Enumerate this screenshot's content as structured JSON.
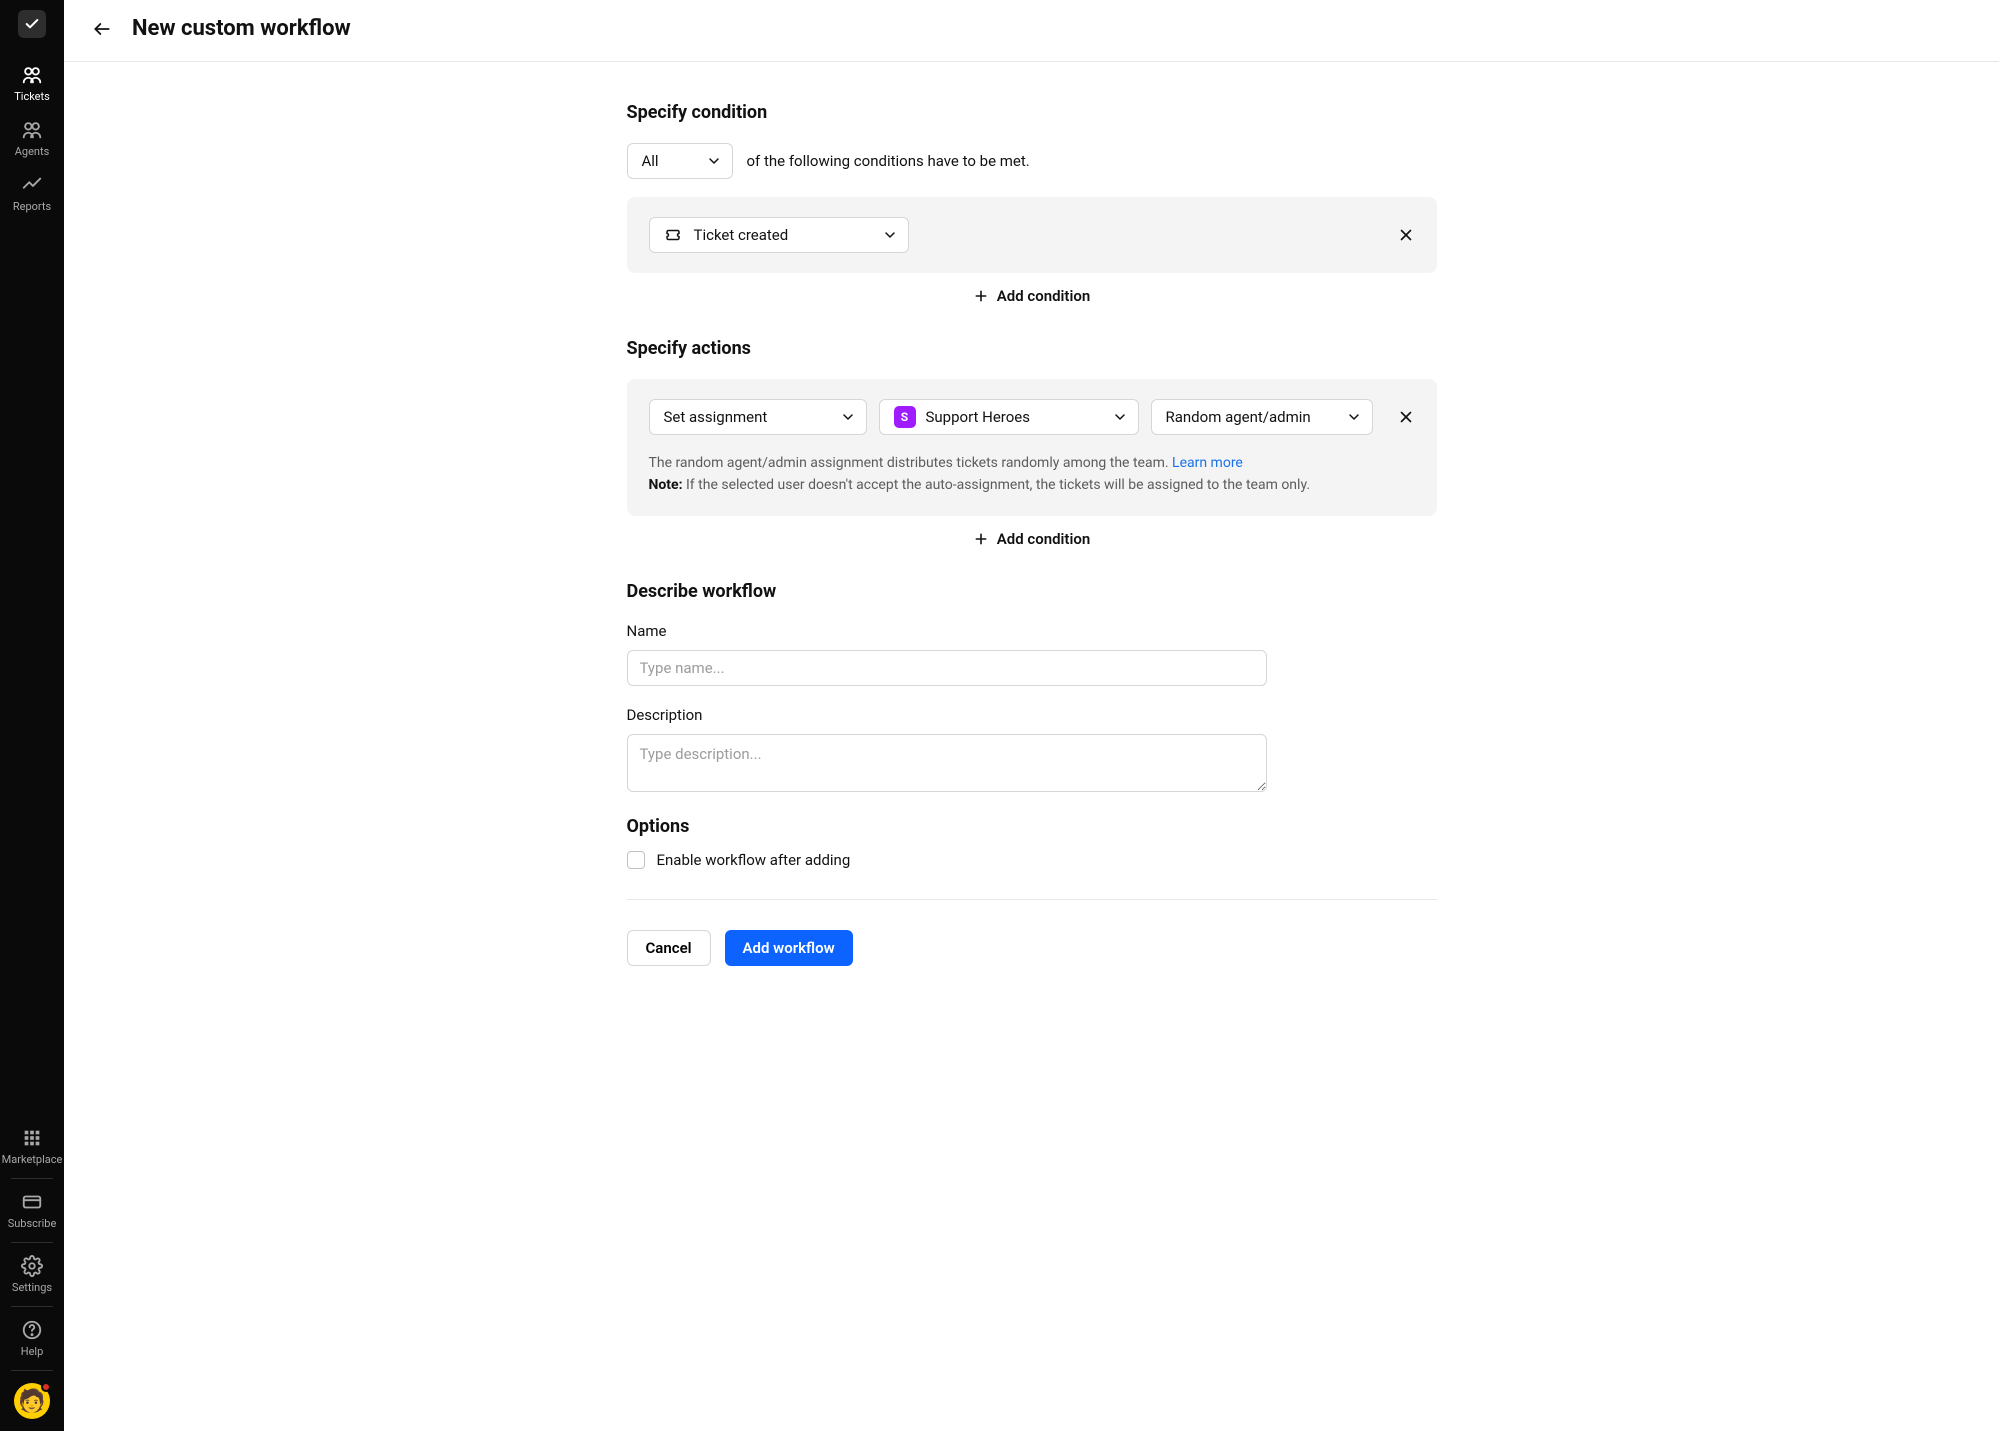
{
  "sidebar": {
    "items": [
      {
        "label": "Tickets"
      },
      {
        "label": "Agents"
      },
      {
        "label": "Reports"
      }
    ],
    "bottom": [
      {
        "label": "Marketplace"
      },
      {
        "label": "Subscribe"
      },
      {
        "label": "Settings"
      },
      {
        "label": "Help"
      }
    ]
  },
  "header": {
    "title": "New custom workflow"
  },
  "conditions": {
    "title": "Specify condition",
    "scope": "All",
    "suffix": "of the following conditions have to be met.",
    "item1": "Ticket created",
    "add_label": "Add condition"
  },
  "actions": {
    "title": "Specify actions",
    "action_type": "Set assignment",
    "team_initial": "S",
    "team": "Support Heroes",
    "assignee": "Random agent/admin",
    "info_line1": "The random agent/admin assignment distributes tickets randomly among the team. ",
    "learn_more": "Learn more",
    "note_prefix": "Note:",
    "note_text": " If the selected user doesn't accept the auto-assignment, the tickets will be assigned to the team only.",
    "add_label": "Add condition"
  },
  "describe": {
    "title": "Describe workflow",
    "name_label": "Name",
    "name_placeholder": "Type name...",
    "desc_label": "Description",
    "desc_placeholder": "Type description..."
  },
  "options": {
    "title": "Options",
    "enable_label": "Enable workflow after adding"
  },
  "footer": {
    "cancel": "Cancel",
    "add": "Add workflow"
  }
}
